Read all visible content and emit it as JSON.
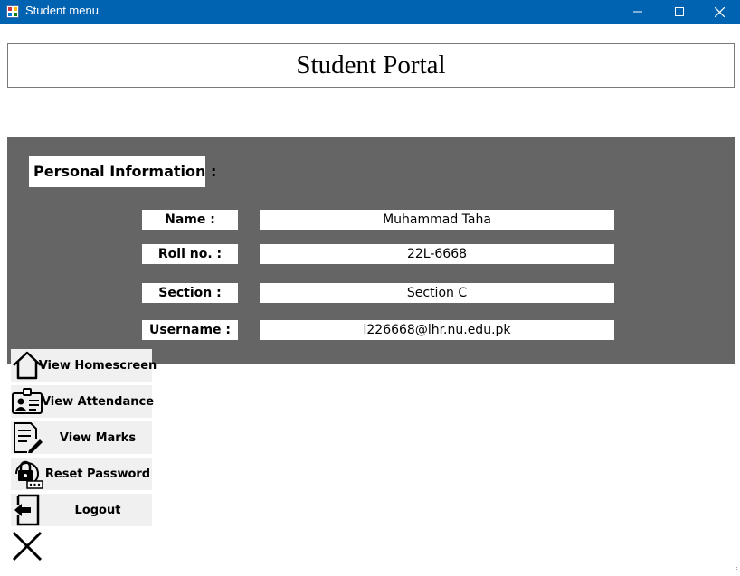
{
  "window": {
    "title": "Student menu",
    "controls": [
      "minimize",
      "maximize",
      "close"
    ]
  },
  "portal": {
    "title": "Student Portal"
  },
  "personal_info": {
    "header": "Personal Information :",
    "fields": [
      {
        "label": "Name :",
        "value": "Muhammad Taha"
      },
      {
        "label": "Roll no. :",
        "value": "22L-6668"
      },
      {
        "label": "Section :",
        "value": "Section C"
      },
      {
        "label": "Username :",
        "value": "l226668@lhr.nu.edu.pk"
      }
    ]
  },
  "nav": [
    {
      "label": "View Homescreen",
      "icon": "home-icon"
    },
    {
      "label": "View Attendance",
      "icon": "id-card-icon"
    },
    {
      "label": "View Marks",
      "icon": "document-edit-icon"
    },
    {
      "label": "Reset Password",
      "icon": "lock-reset-icon"
    },
    {
      "label": "Logout",
      "icon": "logout-icon"
    }
  ],
  "exit_icon": "close-x-icon",
  "colors": {
    "titlebar": "#0063b1",
    "panel": "#656565",
    "button_bg": "#f0f0f0"
  }
}
